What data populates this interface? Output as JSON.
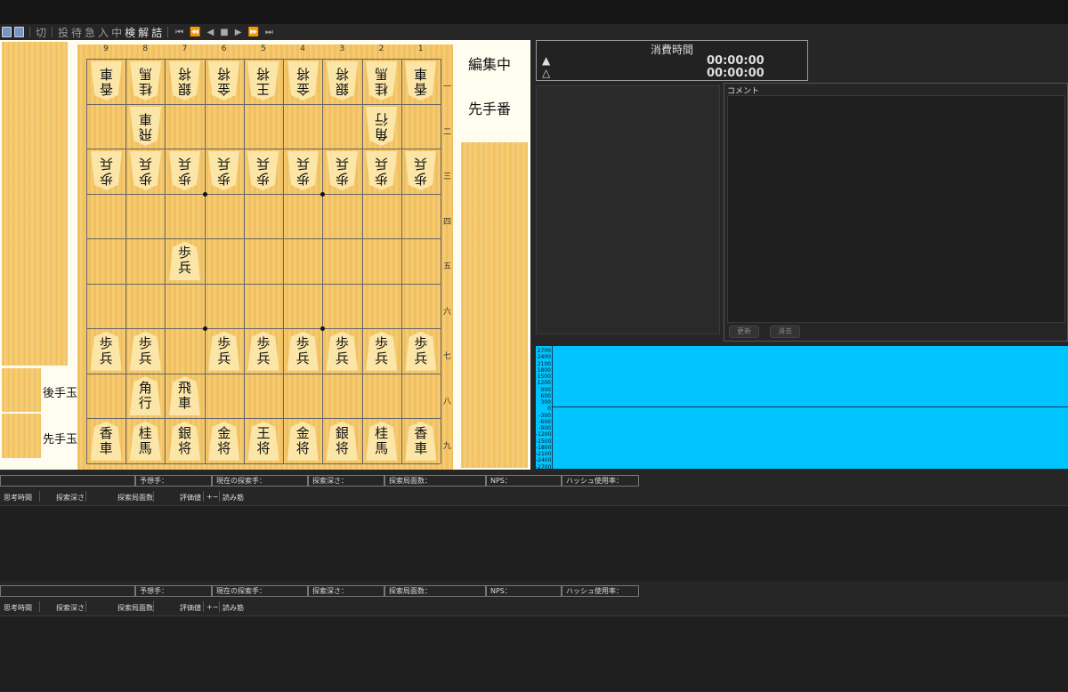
{
  "toolbar": {
    "items": [
      "切",
      "投",
      "待",
      "急",
      "入",
      "中",
      "検",
      "解",
      "詰"
    ],
    "nav_first": "⏮",
    "nav_prev10": "⏪",
    "nav_prev": "◀",
    "nav_stop": "■",
    "nav_next": "▶",
    "nav_next10": "⏩",
    "nav_last": "⏭"
  },
  "board": {
    "columns": [
      "9",
      "8",
      "7",
      "6",
      "5",
      "4",
      "3",
      "2",
      "1"
    ],
    "rows": [
      "一",
      "二",
      "三",
      "四",
      "五",
      "六",
      "七",
      "八",
      "九"
    ],
    "gote_hand_label": "後手玉",
    "sente_hand_label": "先手玉",
    "status_editing": "編集中",
    "status_turn": "先手番",
    "pieces": [
      {
        "c": 0,
        "r": 0,
        "a": "香",
        "b": "車",
        "g": true
      },
      {
        "c": 1,
        "r": 0,
        "a": "桂",
        "b": "馬",
        "g": true
      },
      {
        "c": 2,
        "r": 0,
        "a": "銀",
        "b": "将",
        "g": true
      },
      {
        "c": 3,
        "r": 0,
        "a": "金",
        "b": "将",
        "g": true
      },
      {
        "c": 4,
        "r": 0,
        "a": "王",
        "b": "将",
        "g": true
      },
      {
        "c": 5,
        "r": 0,
        "a": "金",
        "b": "将",
        "g": true
      },
      {
        "c": 6,
        "r": 0,
        "a": "銀",
        "b": "将",
        "g": true
      },
      {
        "c": 7,
        "r": 0,
        "a": "桂",
        "b": "馬",
        "g": true
      },
      {
        "c": 8,
        "r": 0,
        "a": "香",
        "b": "車",
        "g": true
      },
      {
        "c": 1,
        "r": 1,
        "a": "飛",
        "b": "車",
        "g": true
      },
      {
        "c": 7,
        "r": 1,
        "a": "角",
        "b": "行",
        "g": true
      },
      {
        "c": 0,
        "r": 2,
        "a": "歩",
        "b": "兵",
        "g": true
      },
      {
        "c": 1,
        "r": 2,
        "a": "歩",
        "b": "兵",
        "g": true
      },
      {
        "c": 2,
        "r": 2,
        "a": "歩",
        "b": "兵",
        "g": true
      },
      {
        "c": 3,
        "r": 2,
        "a": "歩",
        "b": "兵",
        "g": true
      },
      {
        "c": 4,
        "r": 2,
        "a": "歩",
        "b": "兵",
        "g": true
      },
      {
        "c": 5,
        "r": 2,
        "a": "歩",
        "b": "兵",
        "g": true
      },
      {
        "c": 6,
        "r": 2,
        "a": "歩",
        "b": "兵",
        "g": true
      },
      {
        "c": 7,
        "r": 2,
        "a": "歩",
        "b": "兵",
        "g": true
      },
      {
        "c": 8,
        "r": 2,
        "a": "歩",
        "b": "兵",
        "g": true
      },
      {
        "c": 2,
        "r": 4,
        "a": "歩",
        "b": "兵",
        "g": false
      },
      {
        "c": 0,
        "r": 6,
        "a": "歩",
        "b": "兵",
        "g": false
      },
      {
        "c": 1,
        "r": 6,
        "a": "歩",
        "b": "兵",
        "g": false
      },
      {
        "c": 3,
        "r": 6,
        "a": "歩",
        "b": "兵",
        "g": false
      },
      {
        "c": 4,
        "r": 6,
        "a": "歩",
        "b": "兵",
        "g": false
      },
      {
        "c": 5,
        "r": 6,
        "a": "歩",
        "b": "兵",
        "g": false
      },
      {
        "c": 6,
        "r": 6,
        "a": "歩",
        "b": "兵",
        "g": false
      },
      {
        "c": 7,
        "r": 6,
        "a": "歩",
        "b": "兵",
        "g": false
      },
      {
        "c": 8,
        "r": 6,
        "a": "歩",
        "b": "兵",
        "g": false
      },
      {
        "c": 1,
        "r": 7,
        "a": "角",
        "b": "行",
        "g": false
      },
      {
        "c": 2,
        "r": 7,
        "a": "飛",
        "b": "車",
        "g": false
      },
      {
        "c": 0,
        "r": 8,
        "a": "香",
        "b": "車",
        "g": false
      },
      {
        "c": 1,
        "r": 8,
        "a": "桂",
        "b": "馬",
        "g": false
      },
      {
        "c": 2,
        "r": 8,
        "a": "銀",
        "b": "将",
        "g": false
      },
      {
        "c": 3,
        "r": 8,
        "a": "金",
        "b": "将",
        "g": false
      },
      {
        "c": 4,
        "r": 8,
        "a": "王",
        "b": "将",
        "g": false
      },
      {
        "c": 5,
        "r": 8,
        "a": "金",
        "b": "将",
        "g": false
      },
      {
        "c": 6,
        "r": 8,
        "a": "銀",
        "b": "将",
        "g": false
      },
      {
        "c": 7,
        "r": 8,
        "a": "桂",
        "b": "馬",
        "g": false
      },
      {
        "c": 8,
        "r": 8,
        "a": "香",
        "b": "車",
        "g": false
      }
    ]
  },
  "timer": {
    "header": "消費時間",
    "sente_symbol": "▲",
    "sente_time": "00:00:00",
    "gote_symbol": "△",
    "gote_time": "00:00:00"
  },
  "comment": {
    "label": "コメント",
    "update_button": "更新",
    "delete_button": "消去"
  },
  "graph": {
    "ticks": [
      "2700",
      "2400",
      "2100",
      "1800",
      "1500",
      "1200",
      "900",
      "600",
      "300",
      "0",
      "-300",
      "-600",
      "-900",
      "-1200",
      "-1500",
      "-1800",
      "-2100",
      "-2400",
      "-2700"
    ],
    "background_color": "#00c4ff"
  },
  "engine": {
    "stats": [
      "",
      "予想手：",
      "現在の探索手：",
      "探索深さ：",
      "探索局面数：",
      "NPS：",
      "ハッシュ使用率："
    ],
    "headers": [
      "思考時間",
      "探索深さ",
      "探索局面数",
      "評価値",
      "+−",
      "読み筋"
    ]
  }
}
